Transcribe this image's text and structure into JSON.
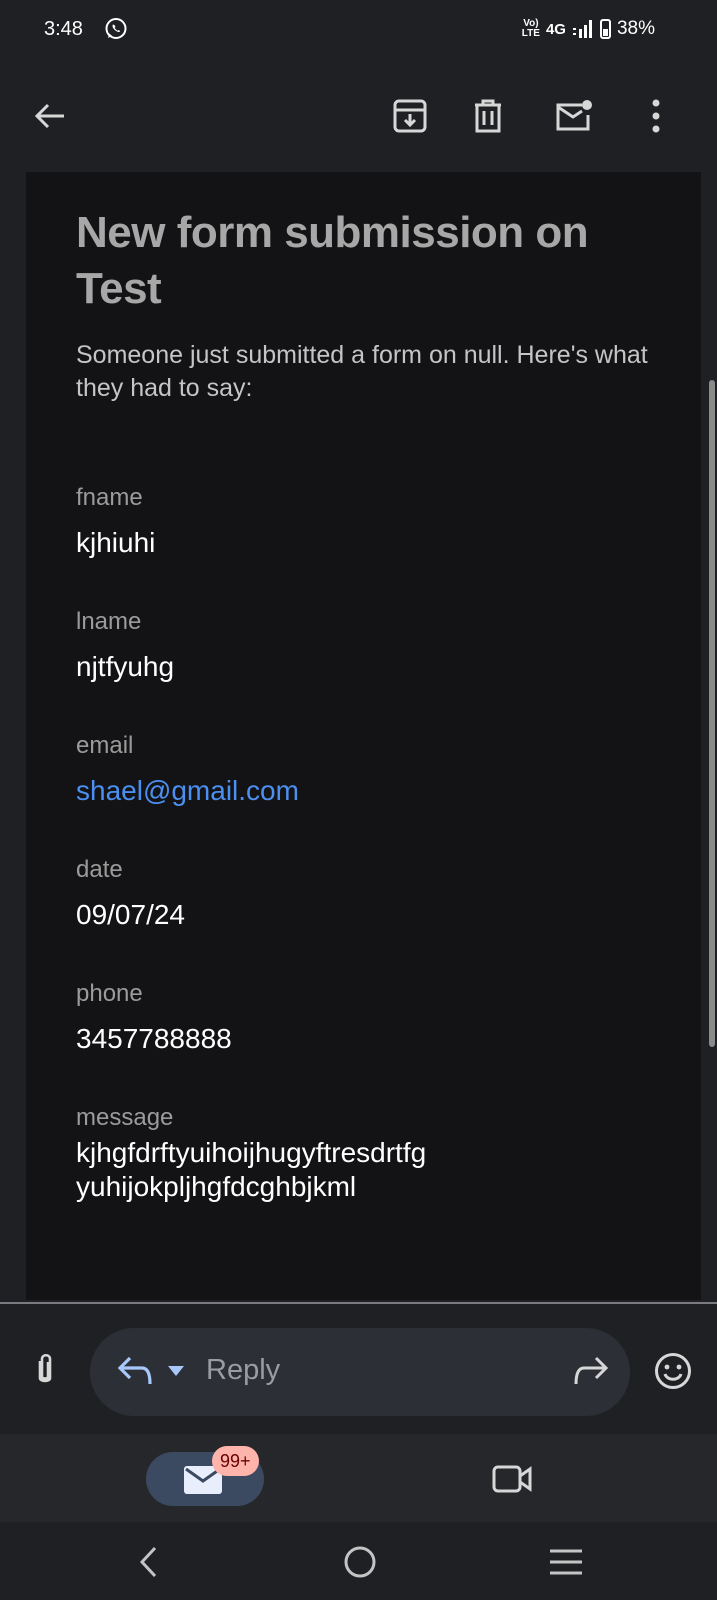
{
  "status_bar": {
    "time": "3:48",
    "network": "4G",
    "volte": "LTE",
    "battery": "38%"
  },
  "app_bar": {
    "actions": [
      "back-icon",
      "archive-icon",
      "delete-icon",
      "mark-unread-icon",
      "more-icon"
    ]
  },
  "email": {
    "title": "New form submission on Test",
    "intro": "Someone just submitted a form on null. Here's what they had to say:",
    "fields": [
      {
        "label": "fname",
        "value": "kjhiuhi"
      },
      {
        "label": "lname",
        "value": "njtfyuhg"
      },
      {
        "label": "email",
        "value": "shael@gmail.com"
      },
      {
        "label": "date",
        "value": "09/07/24"
      },
      {
        "label": "phone",
        "value": "3457788888"
      },
      {
        "label": "message",
        "value": "kjhgfdrftyuihoijhugyftresdrtfg yuhijokpljhgfdcghbjkml"
      }
    ]
  },
  "reply_bar": {
    "placeholder": "Reply"
  },
  "bottom_nav": {
    "mail_badge": "99+"
  },
  "colors": {
    "background": "#1f2023",
    "body": "#131315",
    "link": "#4b8ff0",
    "accent": "#a8c7fa",
    "badge": "#ffb4ab"
  }
}
